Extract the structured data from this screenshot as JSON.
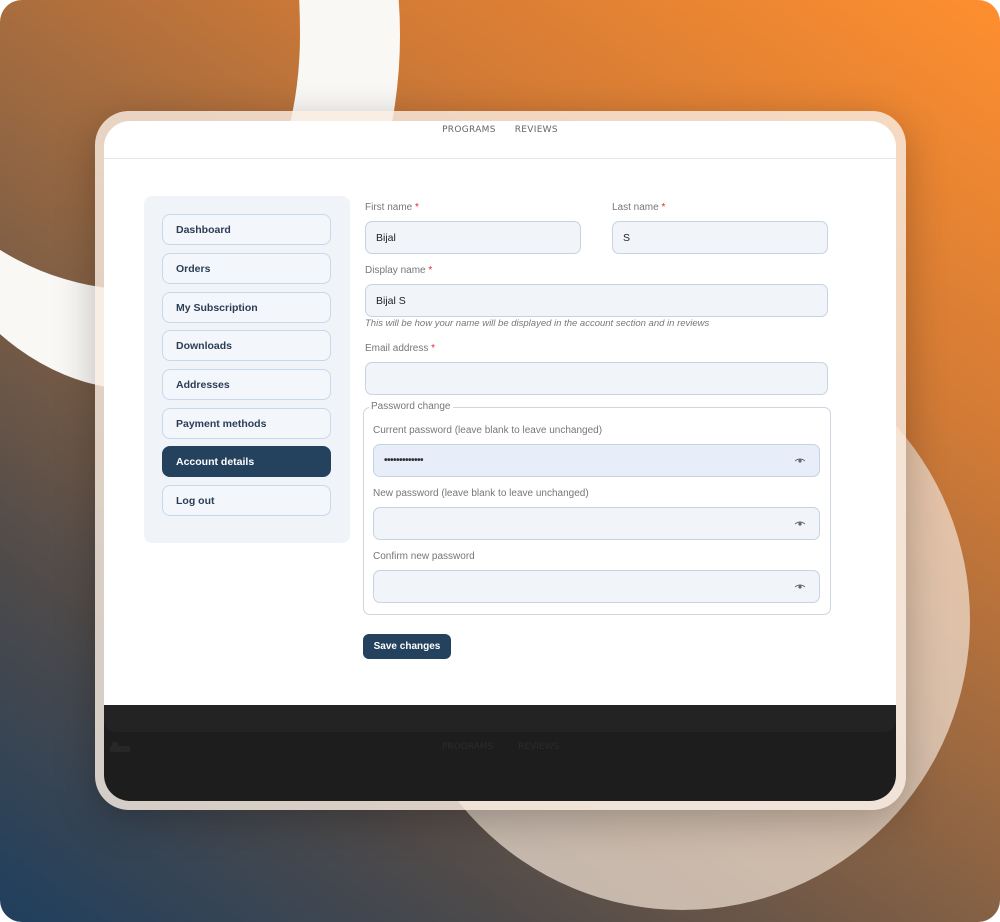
{
  "header": {
    "nav": [
      "PROGRAMS",
      "REVIEWS"
    ]
  },
  "sidebar": {
    "items": [
      {
        "label": "Dashboard",
        "active": false
      },
      {
        "label": "Orders",
        "active": false
      },
      {
        "label": "My Subscription",
        "active": false
      },
      {
        "label": "Downloads",
        "active": false
      },
      {
        "label": "Addresses",
        "active": false
      },
      {
        "label": "Payment methods",
        "active": false
      },
      {
        "label": "Account details",
        "active": true
      },
      {
        "label": "Log out",
        "active": false
      }
    ]
  },
  "form": {
    "first_name": {
      "label": "First name",
      "required_mark": "*",
      "value": "Bijal"
    },
    "last_name": {
      "label": "Last name",
      "required_mark": "*",
      "value": "S"
    },
    "display_name": {
      "label": "Display name",
      "required_mark": "*",
      "value": "Bijal S",
      "help": "This will be how your name will be displayed in the account section and in reviews"
    },
    "email": {
      "label": "Email address",
      "required_mark": "*",
      "value": ""
    },
    "password_change": {
      "legend": "Password change",
      "current": {
        "label": "Current password (leave blank to leave unchanged)",
        "value_masked": "•••••••••••••"
      },
      "new": {
        "label": "New password (leave blank to leave unchanged)",
        "value_masked": ""
      },
      "confirm": {
        "label": "Confirm new password",
        "value_masked": ""
      },
      "toggle_icon": "eye-icon"
    },
    "save_label": "Save changes"
  },
  "footer": {
    "nav": [
      "PROGRAMS",
      "REVIEWS"
    ],
    "logo_icon": "logo-icon"
  },
  "colors": {
    "primary": "#24415e",
    "required": "#ee2233",
    "input_bg": "#f1f4f9",
    "accent_orange": "#ff8f2f"
  }
}
